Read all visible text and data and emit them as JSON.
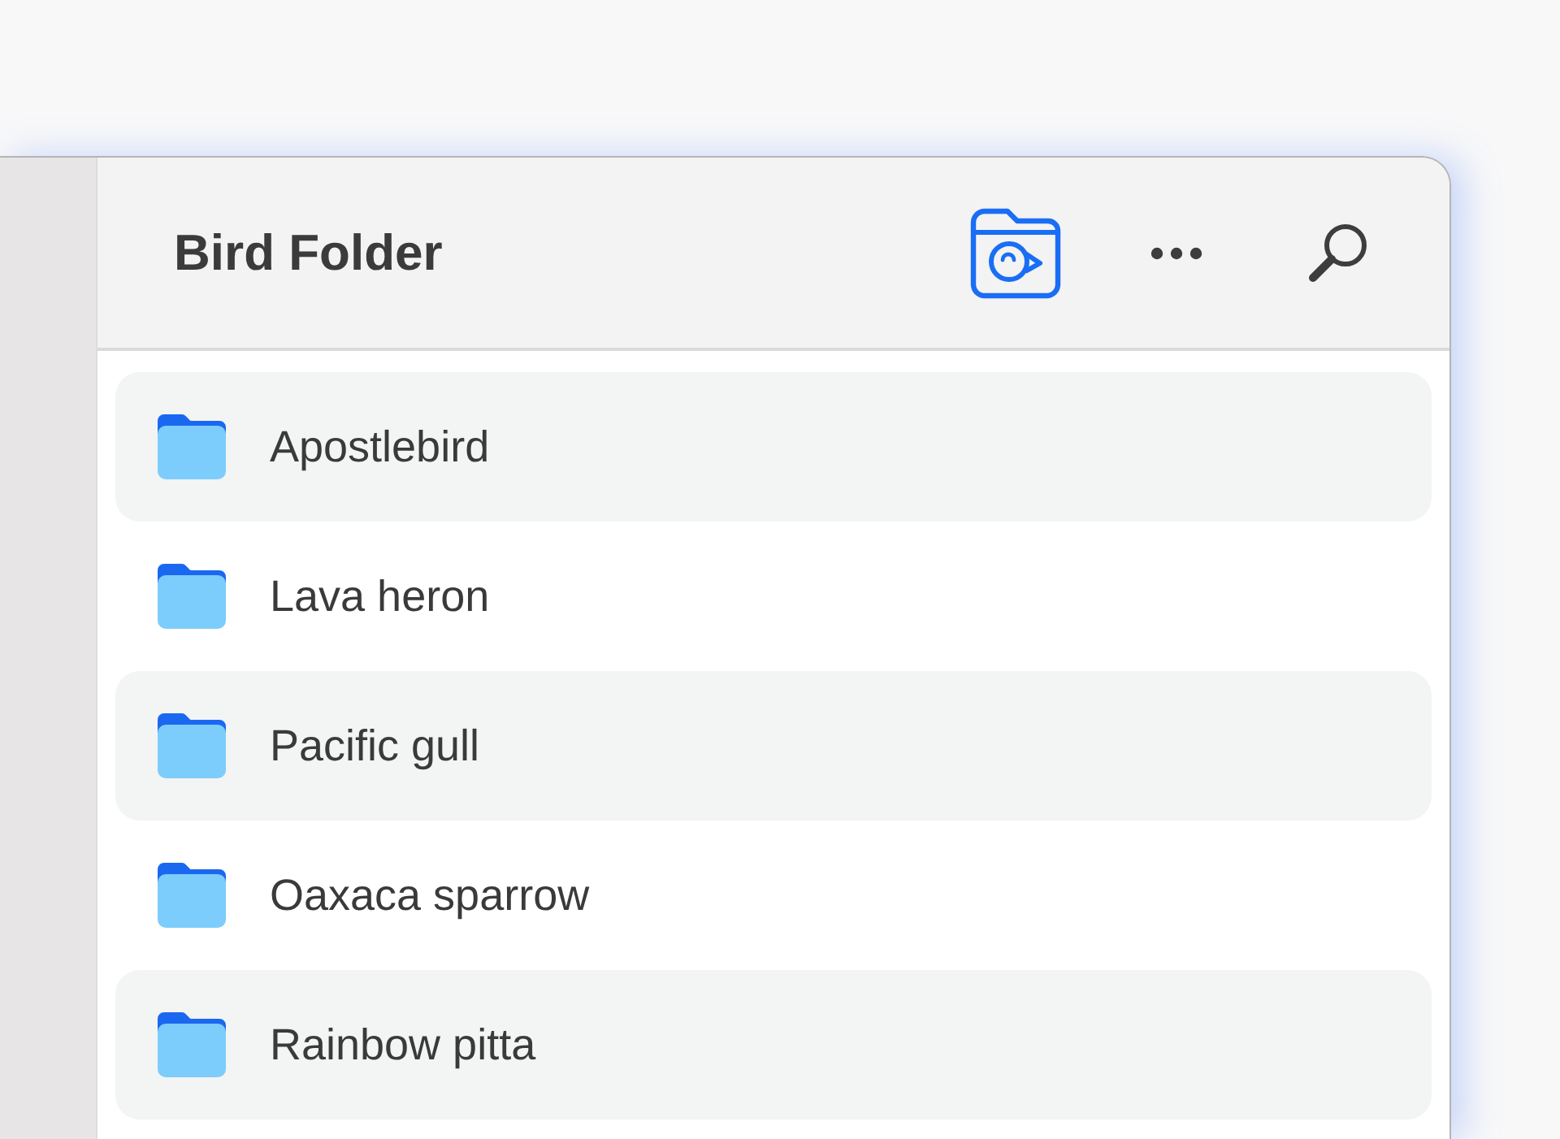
{
  "window": {
    "title": "Bird Folder"
  },
  "folders": [
    {
      "name": "Apostlebird"
    },
    {
      "name": "Lava heron"
    },
    {
      "name": "Pacific gull"
    },
    {
      "name": "Oaxaca sparrow"
    },
    {
      "name": "Rainbow pitta"
    }
  ]
}
